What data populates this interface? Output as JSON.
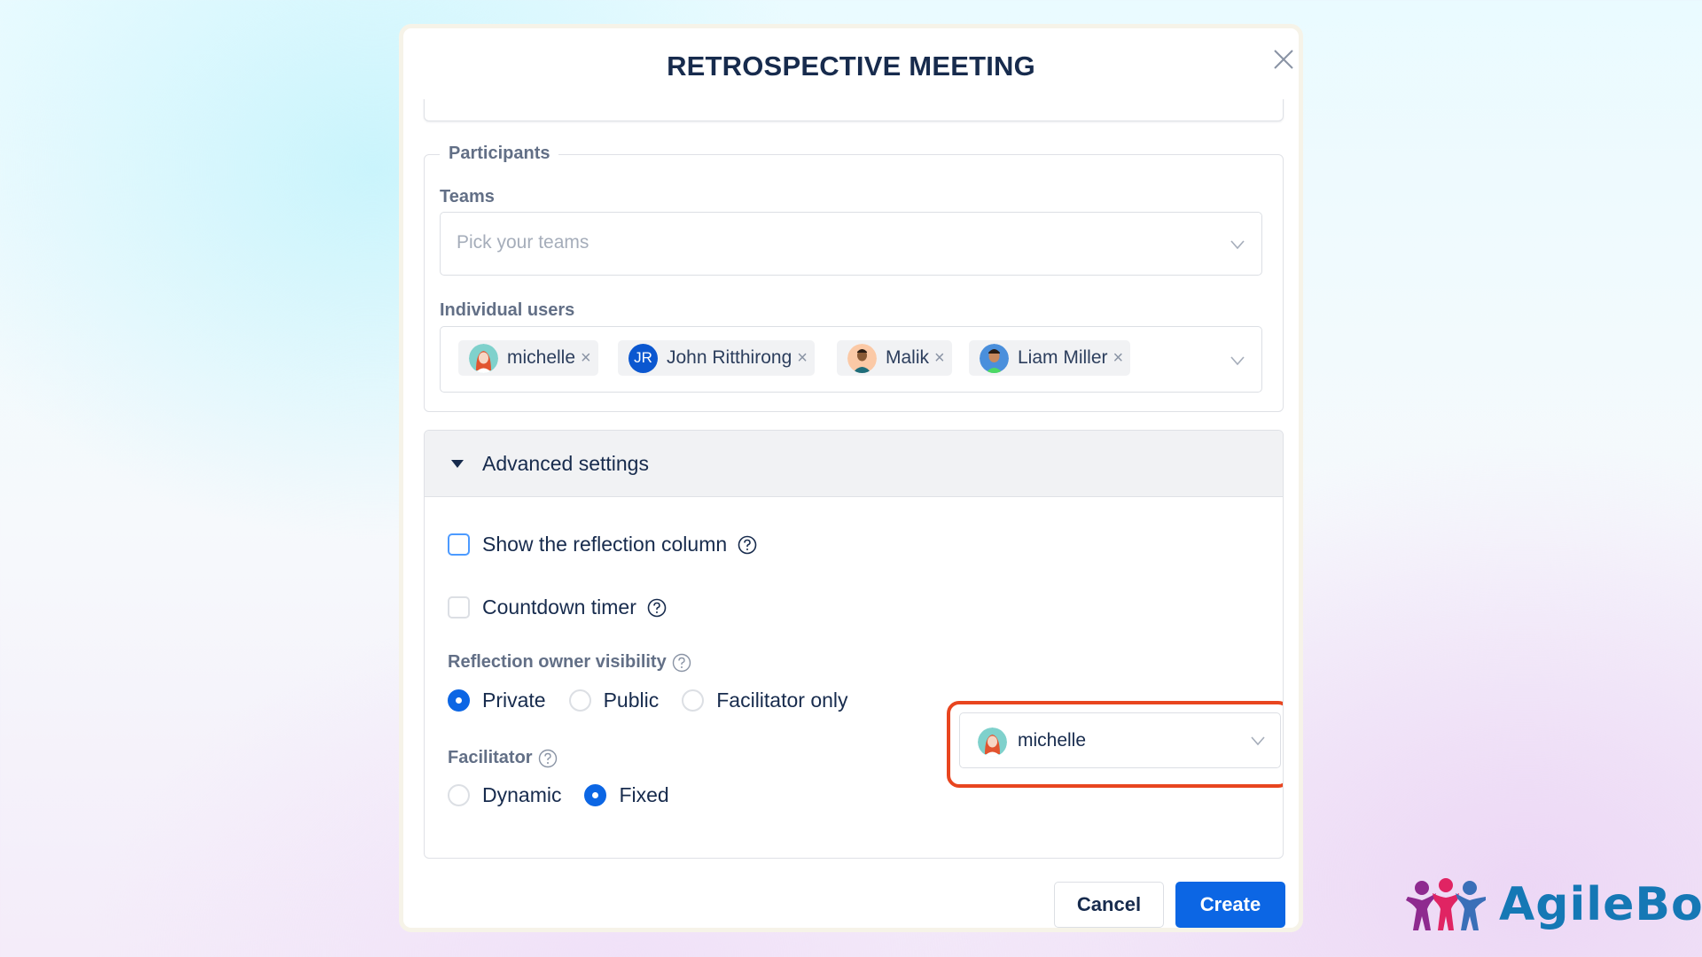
{
  "modal": {
    "title": "RETROSPECTIVE MEETING",
    "close_icon": "close-icon"
  },
  "participants": {
    "legend": "Participants",
    "teams": {
      "label": "Teams",
      "placeholder": "Pick your teams",
      "icon": "chevron-down-icon"
    },
    "individual_users": {
      "label": "Individual users",
      "chips": [
        {
          "name": "michelle",
          "avatar": "avatar-michelle",
          "initials": ""
        },
        {
          "name": "John Ritthirong",
          "avatar": "avatar-initials",
          "initials": "JR"
        },
        {
          "name": "Malik",
          "avatar": "avatar-malik",
          "initials": ""
        },
        {
          "name": "Liam Miller",
          "avatar": "avatar-liam",
          "initials": ""
        }
      ],
      "remove_glyph": "×",
      "icon": "chevron-down-icon"
    }
  },
  "advanced": {
    "header": "Advanced settings",
    "expanded": true,
    "show_reflection_column": {
      "label": "Show the reflection column",
      "checked": false
    },
    "countdown_timer": {
      "label": "Countdown timer",
      "checked": false
    },
    "reflection_owner_visibility": {
      "label": "Reflection owner visibility",
      "options": [
        "Private",
        "Public",
        "Facilitator only"
      ],
      "selected": "Private"
    },
    "facilitator": {
      "label": "Facilitator",
      "options": [
        "Dynamic",
        "Fixed"
      ],
      "selected": "Fixed",
      "selected_user": "michelle"
    }
  },
  "footer": {
    "cancel": "Cancel",
    "create": "Create"
  },
  "branding": {
    "logo_text": "AgileBox"
  },
  "colors": {
    "primary": "#0c66e4",
    "highlight": "#e8451f",
    "title": "#172b4d",
    "logo": "#1578b5"
  }
}
